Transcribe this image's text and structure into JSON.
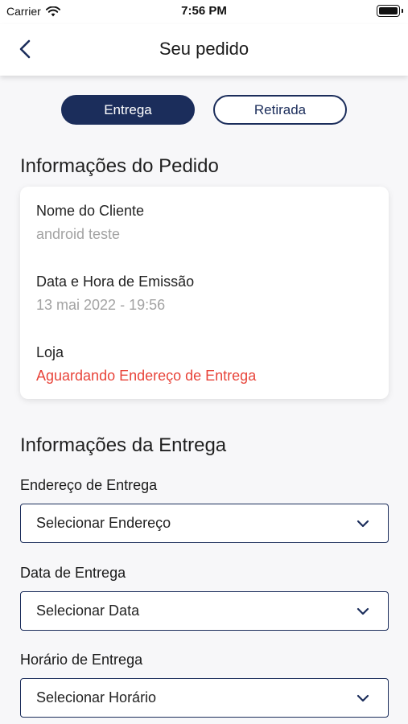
{
  "status_bar": {
    "carrier": "Carrier",
    "time": "7:56 PM",
    "battery_level": 1.0
  },
  "header": {
    "title": "Seu pedido"
  },
  "tabs": [
    {
      "label": "Entrega",
      "active": true
    },
    {
      "label": "Retirada",
      "active": false
    }
  ],
  "order_info": {
    "title": "Informações do Pedido",
    "customer_label": "Nome do Cliente",
    "customer_value": "android teste",
    "issued_label": "Data e Hora de Emissão",
    "issued_value": "13 mai 2022 - 19:56",
    "store_label": "Loja",
    "store_value": "Aguardando Endereço de Entrega"
  },
  "delivery_info": {
    "title": "Informações da Entrega",
    "address_label": "Endereço de Entrega",
    "address_placeholder": "Selecionar Endereço",
    "date_label": "Data de Entrega",
    "date_placeholder": "Selecionar Data",
    "time_label": "Horário de Entrega",
    "time_placeholder": "Selecionar Horário"
  },
  "colors": {
    "primary": "#1b2d5b",
    "alert": "#e8443a",
    "muted": "#a3a3a3",
    "background": "#f7f7f9"
  },
  "icons": [
    "wifi-icon",
    "battery-icon",
    "back-chevron-icon",
    "chevron-down-icon"
  ]
}
